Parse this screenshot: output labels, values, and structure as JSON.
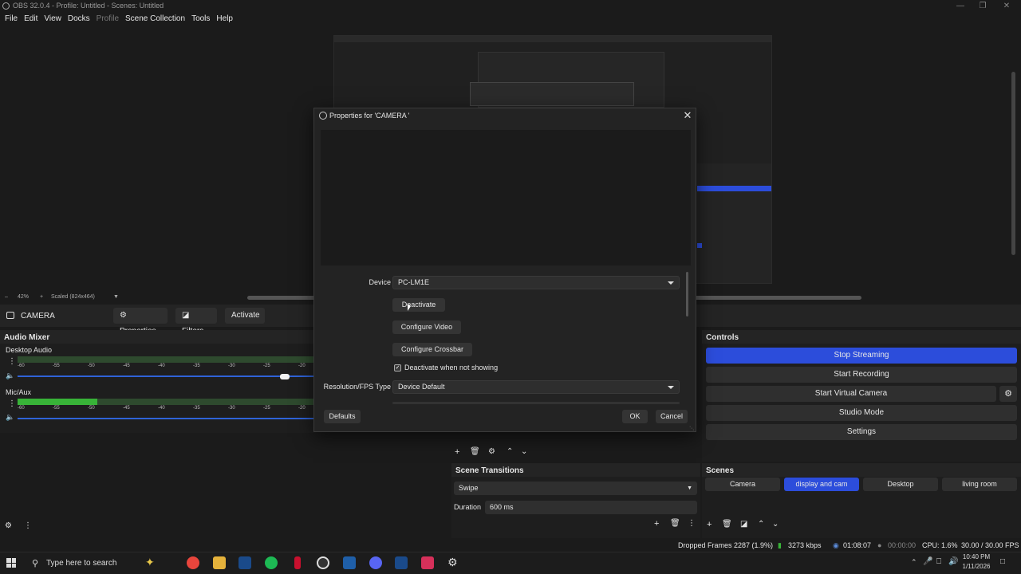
{
  "window": {
    "title": "OBS 32.0.4 - Profile: Untitled - Scenes: Untitled",
    "min_icon": "minimize-icon",
    "max_icon": "maximize-icon",
    "close_icon": "close-icon"
  },
  "menu": [
    "File",
    "Edit",
    "View",
    "Docks",
    "Profile",
    "Scene Collection",
    "Tools",
    "Help"
  ],
  "preview": {
    "zoom": "42%",
    "scaled": "Scaled (824x464)"
  },
  "source_toolbar": {
    "source_name": "CAMERA",
    "properties": "Properties",
    "filters": "Filters",
    "activate": "Activate"
  },
  "audio_mixer": {
    "title": "Audio Mixer",
    "scale": [
      "-60",
      "-55",
      "-50",
      "-45",
      "-40",
      "-35",
      "-30",
      "-25",
      "-20"
    ],
    "channels": [
      {
        "name": "Desktop Audio",
        "level": 0.0,
        "volume": 0.9
      },
      {
        "name": "Mic/Aux",
        "level": 0.27,
        "volume": 1.0
      }
    ]
  },
  "controls": {
    "title": "Controls",
    "buttons": [
      "Stop Streaming",
      "Start Recording",
      "Start Virtual Camera",
      "Studio Mode",
      "Settings"
    ]
  },
  "scenes": {
    "title": "Scenes",
    "items": [
      "Camera",
      "display and cam",
      "Desktop",
      "living room"
    ],
    "active": "display and cam"
  },
  "transitions": {
    "title": "Scene Transitions",
    "selected": "Swipe",
    "duration_label": "Duration",
    "duration_value": "600 ms"
  },
  "dialog": {
    "title": "Properties for 'CAMERA '",
    "device_label": "Device",
    "device_value": "PC-LM1E",
    "deactivate": "Deactivate",
    "configure_video": "Configure Video",
    "configure_crossbar": "Configure Crossbar",
    "deactivate_when_not_showing": "Deactivate when not showing",
    "resolution_label": "Resolution/FPS Type",
    "resolution_value": "Device Default",
    "defaults": "Defaults",
    "ok": "OK",
    "cancel": "Cancel"
  },
  "status": {
    "dropped_frames": "Dropped Frames 2287 (1.9%)",
    "bitrate": "3273 kbps",
    "stream_time": "01:08:07",
    "rec_time": "00:00:00",
    "cpu": "CPU: 1.6%",
    "fps": "30.00 / 30.00 FPS"
  },
  "taskbar": {
    "search_placeholder": "Type here to search",
    "time": "10:40 PM",
    "date": "1/11/2026"
  },
  "colors": {
    "accent": "#2c4ddb",
    "meter_green": "#38b338",
    "background": "#1b1b1b"
  }
}
